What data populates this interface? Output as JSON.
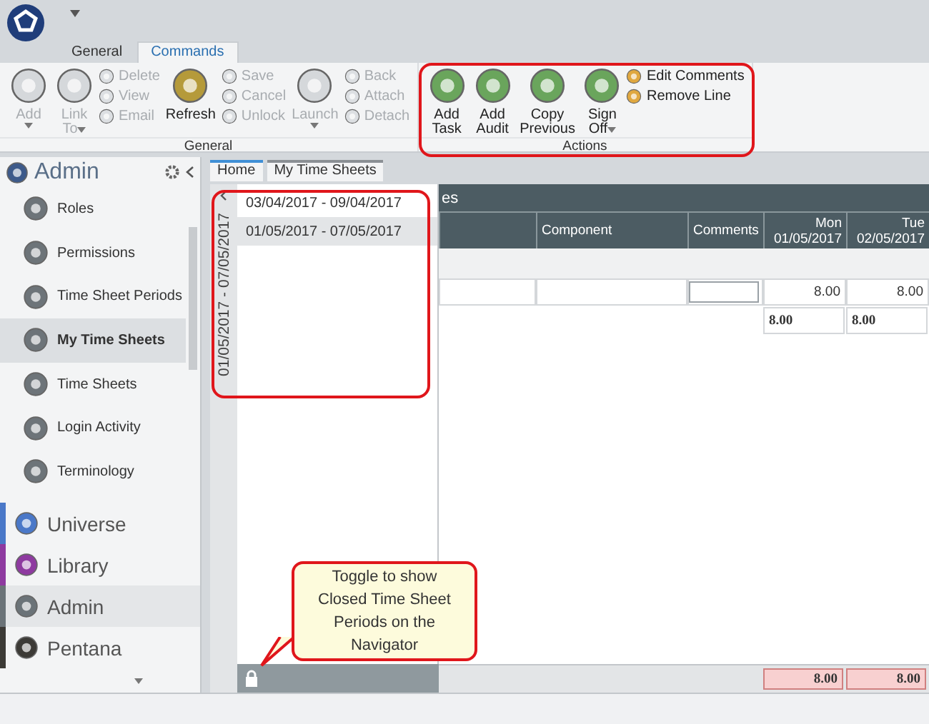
{
  "ribbon_tabs": [
    {
      "label": "General",
      "selected": false
    },
    {
      "label": "Commands",
      "selected": true
    }
  ],
  "ribbon_groups": [
    {
      "label": "General",
      "highlighted": false,
      "columns": [
        {
          "kind": "large",
          "lines": [
            "Add"
          ],
          "disabled": true,
          "dropdown": true
        },
        {
          "kind": "large",
          "lines": [
            "Link",
            "To"
          ],
          "disabled": true,
          "dropdown": true
        },
        {
          "kind": "stack",
          "items": [
            {
              "label": "Delete",
              "disabled": true
            },
            {
              "label": "View",
              "disabled": true
            },
            {
              "label": "Email",
              "disabled": true
            }
          ]
        },
        {
          "kind": "large",
          "lines": [
            "Refresh"
          ],
          "disabled": false,
          "dropdown": false
        },
        {
          "kind": "stack",
          "items": [
            {
              "label": "Save",
              "disabled": true
            },
            {
              "label": "Cancel",
              "disabled": true
            },
            {
              "label": "Unlock",
              "disabled": true
            }
          ]
        },
        {
          "kind": "large",
          "lines": [
            "Launch"
          ],
          "disabled": true,
          "dropdown": true
        },
        {
          "kind": "stack",
          "items": [
            {
              "label": "Back",
              "disabled": true
            },
            {
              "label": "Attach",
              "disabled": true
            },
            {
              "label": "Detach",
              "disabled": true
            }
          ]
        }
      ]
    },
    {
      "label": "Actions",
      "highlighted": true,
      "columns": [
        {
          "kind": "large",
          "lines": [
            "Add",
            "Task"
          ],
          "disabled": false,
          "dropdown": false
        },
        {
          "kind": "large",
          "lines": [
            "Add",
            "Audit"
          ],
          "disabled": false,
          "dropdown": false
        },
        {
          "kind": "large",
          "lines": [
            "Copy",
            "Previous"
          ],
          "disabled": false,
          "dropdown": false
        },
        {
          "kind": "large",
          "lines": [
            "Sign",
            "Off"
          ],
          "disabled": false,
          "dropdown": true
        },
        {
          "kind": "stack",
          "items": [
            {
              "label": "Edit Comments",
              "disabled": false
            },
            {
              "label": "Remove Line",
              "disabled": false
            }
          ]
        }
      ]
    }
  ],
  "sidebar": {
    "title": "Admin",
    "items": [
      {
        "label": "Roles",
        "selected": false
      },
      {
        "label": "Permissions",
        "selected": false
      },
      {
        "label": "Time Sheet Periods",
        "selected": false
      },
      {
        "label": "My Time Sheets",
        "selected": true
      },
      {
        "label": "Time Sheets",
        "selected": false
      },
      {
        "label": "Login Activity",
        "selected": false
      },
      {
        "label": "Terminology",
        "selected": false
      }
    ],
    "modules": [
      {
        "label": "Universe",
        "color": "#4a78c8",
        "selected": false
      },
      {
        "label": "Library",
        "color": "#8e3aa0",
        "selected": false
      },
      {
        "label": "Admin",
        "color": "#6b7378",
        "selected": true
      },
      {
        "label": "Pentana",
        "color": "#3c3a36",
        "selected": false
      }
    ]
  },
  "doc_tabs": [
    {
      "label": "Home",
      "selected": true
    },
    {
      "label": "My Time Sheets",
      "selected": false
    }
  ],
  "navigator": {
    "highlighted": true,
    "current_period": "01/05/2017 - 07/05/2017",
    "periods": [
      {
        "label": "03/04/2017 - 09/04/2017",
        "selected": false
      },
      {
        "label": "01/05/2017 - 07/05/2017",
        "selected": true
      }
    ]
  },
  "grid": {
    "title": "es",
    "columns": [
      {
        "kind": "text",
        "label": "Component"
      },
      {
        "kind": "text",
        "label": "Comments"
      },
      {
        "kind": "day",
        "day": "Mon",
        "date": "01/05/2017"
      },
      {
        "kind": "day",
        "day": "Tue",
        "date": "02/05/2017"
      }
    ],
    "entry_hours": [
      "8.00",
      "8.00"
    ],
    "totals": [
      "8.00",
      "8.00"
    ],
    "footer_totals": [
      "8.00",
      "8.00"
    ]
  },
  "callout": "Toggle to show Closed Time Sheet Periods on the Navigator"
}
